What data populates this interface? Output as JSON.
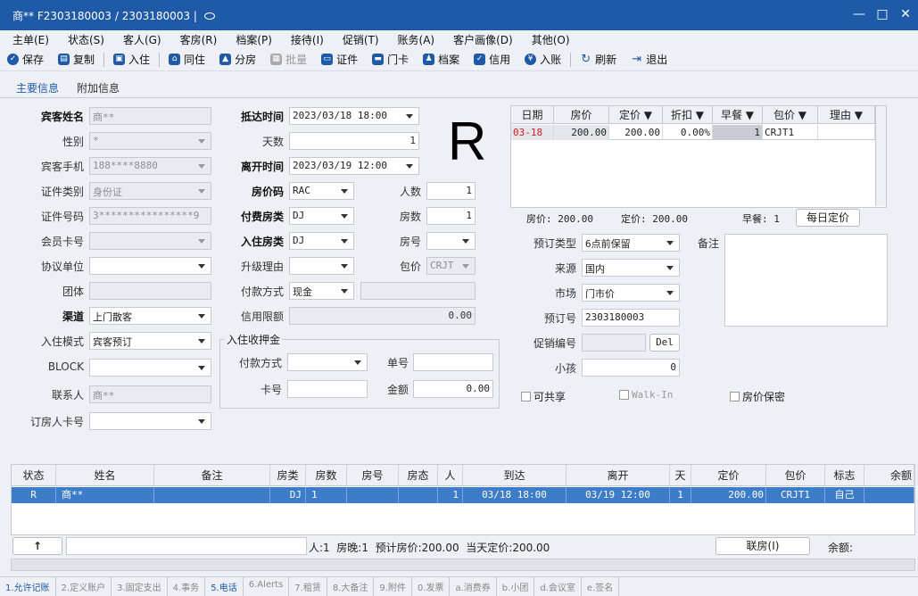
{
  "title": {
    "text": "商** F2303180003 / 2303180003 |",
    "min": "—",
    "max": "□",
    "close": "✕"
  },
  "menu": [
    "主单(E)",
    "状态(S)",
    "客人(G)",
    "客房(R)",
    "档案(P)",
    "接待(I)",
    "促销(T)",
    "账务(A)",
    "客户画像(D)",
    "其他(O)"
  ],
  "toolbar": {
    "save": "保存",
    "copy": "复制",
    "checkin": "入住",
    "together": "同住",
    "split": "分房",
    "batch": "批量",
    "cert": "证件",
    "card": "门卡",
    "archive": "档案",
    "credit": "信用",
    "post": "入账",
    "refresh": "刷新",
    "exit": "退出"
  },
  "tabs": {
    "main": "主要信息",
    "extra": "附加信息"
  },
  "form": {
    "guest_name_label": "宾客姓名",
    "guest_name": "商**",
    "gender_label": "性别",
    "gender": "*",
    "phone_label": "宾客手机",
    "phone": "188****8880",
    "idtype_label": "证件类别",
    "idtype": "身份证",
    "idno_label": "证件号码",
    "idno": "3****************9",
    "member_label": "会员卡号",
    "member": "",
    "agreement_label": "协议单位",
    "agreement": "",
    "group_label": "团体",
    "group": "",
    "channel_label": "渠道",
    "channel": "上门散客",
    "mode_label": "入住模式",
    "mode": "宾客预订",
    "block_label": "BLOCK",
    "block": "",
    "contact_label": "联系人",
    "contact": "商**",
    "booker_label": "订房人卡号",
    "booker": "",
    "arrive_label": "抵达时间",
    "arrive": "2023/03/18 18:00",
    "days_label": "天数",
    "days": "1",
    "depart_label": "离开时间",
    "depart": "2023/03/19 12:00",
    "ratecode_label": "房价码",
    "ratecode": "RAC",
    "paytype_label": "付费房类",
    "paytype": "DJ",
    "roomtype_label": "入住房类",
    "roomtype": "DJ",
    "upgrade_label": "升级理由",
    "upgrade": "",
    "paymethod_label": "付款方式",
    "paymethod": "现金",
    "paymethod2": "",
    "credit_label": "信用限额",
    "credit": "0.00",
    "persons_label": "人数",
    "persons": "1",
    "rooms_label": "房数",
    "rooms": "1",
    "roomno_label": "房号",
    "roomno": "",
    "package_label": "包价",
    "package": "CRJT",
    "status_letter": "R",
    "deposit_group": "入住收押金",
    "dep_pay_label": "付款方式",
    "dep_pay": "",
    "dep_no_label": "单号",
    "dep_no": "",
    "dep_card_label": "卡号",
    "dep_card": "",
    "dep_amt_label": "金额",
    "dep_amt": "0.00",
    "booktype_label": "预订类型",
    "booktype": "6点前保留",
    "source_label": "来源",
    "source": "国内",
    "market_label": "市场",
    "market": "门市价",
    "bookno_label": "预订号",
    "bookno": "2303180003",
    "promo_label": "促销编号",
    "promo": "",
    "del": "Del",
    "child_label": "小孩",
    "child": "0",
    "remark_label": "备注",
    "remark": "",
    "share": "可共享",
    "walkin": "Walk-In",
    "keep": "房价保密"
  },
  "rate_table": {
    "headers": [
      "日期",
      "房价",
      "定价 ▼",
      "折扣 ▼",
      "早餐 ▼",
      "包价 ▼",
      "理由 ▼"
    ],
    "row": [
      "03-18",
      "200.00",
      "200.00",
      "0.00%",
      "1",
      "CRJT1",
      ""
    ],
    "foot_price": "房价: 200.00",
    "foot_fixed": "定价: 200.00",
    "foot_bf": "早餐: 1",
    "daily_btn": "每日定价"
  },
  "grid": {
    "headers": [
      "状态",
      "姓名",
      "备注",
      "房类",
      "房数",
      "房号",
      "房态",
      "人",
      "到达",
      "离开",
      "天",
      "定价",
      "包价",
      "标志",
      "余额"
    ],
    "row": [
      "R",
      "商**",
      "",
      "DJ",
      "1",
      "",
      "",
      "1",
      "03/18 18:00",
      "03/19 12:00",
      "1",
      "200.00",
      "CRJT1",
      "自己",
      ""
    ]
  },
  "bottom": {
    "up": "↑",
    "summary": "人:1  房晚:1  预计房价:200.00  当天定价:200.00",
    "link": "联房(I)",
    "balance": "余额:"
  },
  "bottom_tabs": [
    "1.允许记账",
    "2.定义账户",
    "3.固定支出",
    "4.事务",
    "5.电话",
    "6.Alerts",
    "7.租赁",
    "8.大备注",
    "9.附件",
    "0.发票",
    "a.消费券",
    "b.小团",
    "d.会议室",
    "e.签名"
  ]
}
